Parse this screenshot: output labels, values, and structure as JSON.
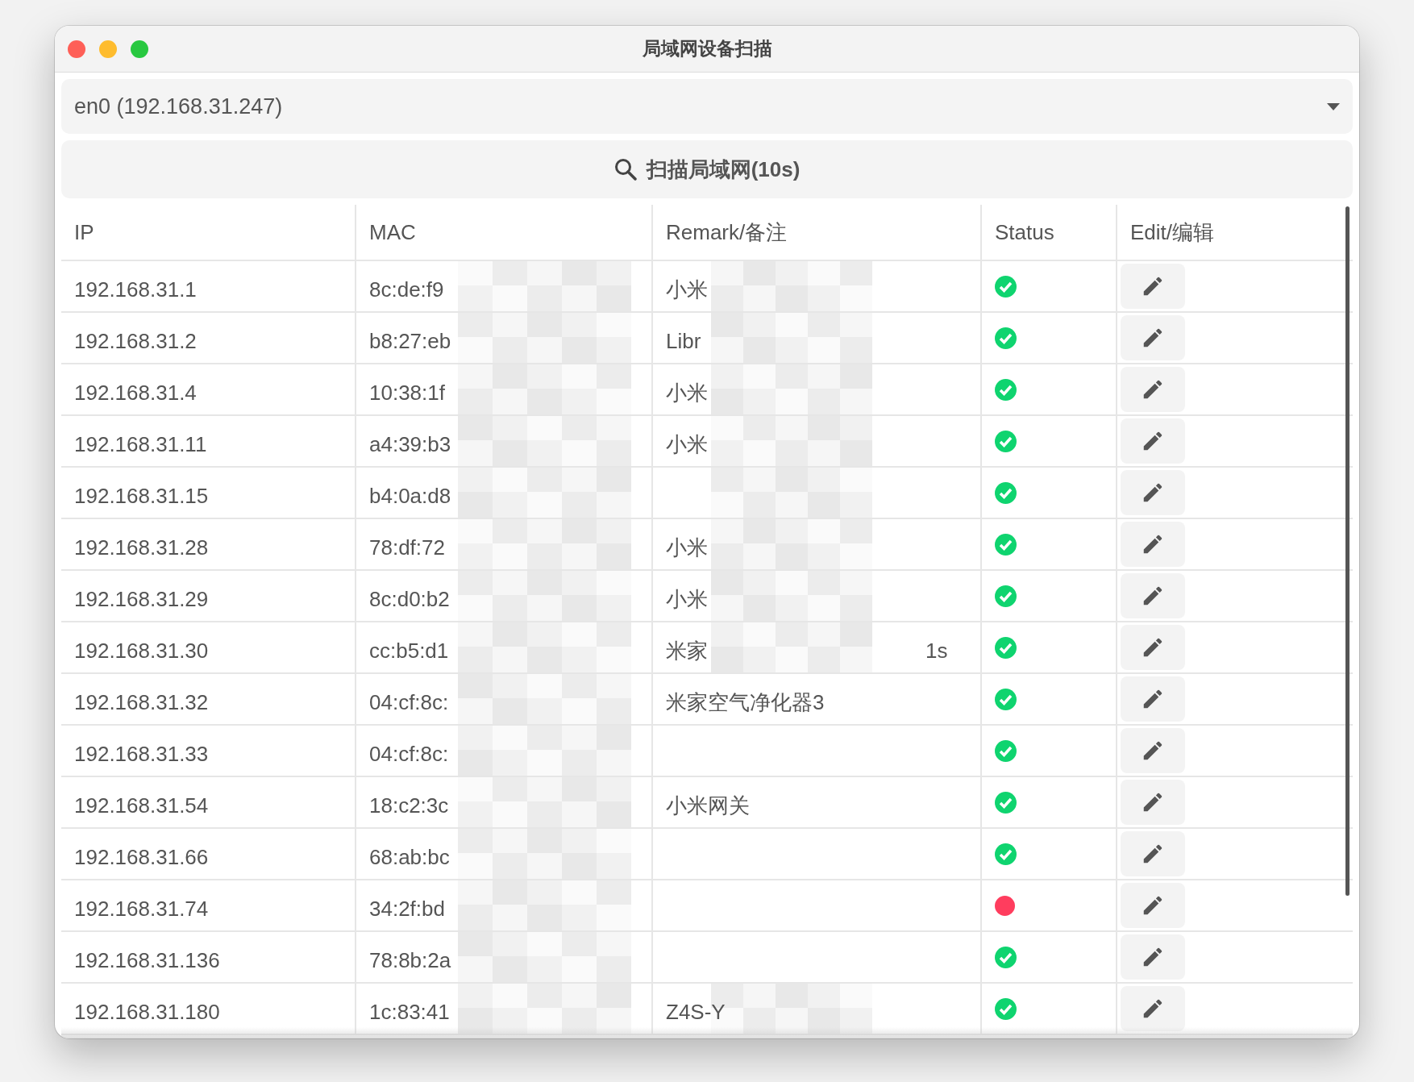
{
  "window": {
    "title": "局域网设备扫描"
  },
  "interface_select": {
    "value": "en0 (192.168.31.247)"
  },
  "scan_button": {
    "label": "扫描局域网(10s)"
  },
  "table": {
    "columns": [
      "IP",
      "MAC",
      "Remark/备注",
      "Status",
      "Edit/编辑"
    ],
    "rows": [
      {
        "ip": "192.168.31.1",
        "mac": "8c:de:f9",
        "mac_redacted": true,
        "remark": "小米",
        "remark_redacted": true,
        "online": true
      },
      {
        "ip": "192.168.31.2",
        "mac": "b8:27:eb",
        "mac_redacted": true,
        "remark": "Libr",
        "remark_redacted": true,
        "online": true
      },
      {
        "ip": "192.168.31.4",
        "mac": "10:38:1f",
        "mac_redacted": true,
        "remark": "小米",
        "remark_redacted": true,
        "online": true
      },
      {
        "ip": "192.168.31.11",
        "mac": "a4:39:b3",
        "mac_redacted": true,
        "remark": "小米",
        "remark_redacted": true,
        "online": true
      },
      {
        "ip": "192.168.31.15",
        "mac": "b4:0a:d8",
        "mac_redacted": true,
        "remark_redacted": true,
        "online": true
      },
      {
        "ip": "192.168.31.28",
        "mac": "78:df:72",
        "mac_redacted": true,
        "remark": "小米",
        "remark_redacted": true,
        "online": true
      },
      {
        "ip": "192.168.31.29",
        "mac": "8c:d0:b2",
        "mac_redacted": true,
        "remark": "小米",
        "remark_redacted": true,
        "online": true
      },
      {
        "ip": "192.168.31.30",
        "mac": "cc:b5:d1",
        "mac_redacted": true,
        "remark": "米家",
        "remark_tail": "1s",
        "remark_redacted": true,
        "online": true
      },
      {
        "ip": "192.168.31.32",
        "mac": "04:cf:8c:",
        "mac_redacted": true,
        "remark": "米家空气净化器3",
        "online": true
      },
      {
        "ip": "192.168.31.33",
        "mac": "04:cf:8c:",
        "mac_redacted": true,
        "online": true
      },
      {
        "ip": "192.168.31.54",
        "mac": "18:c2:3c",
        "mac_redacted": true,
        "remark": "小米网关",
        "online": true
      },
      {
        "ip": "192.168.31.66",
        "mac": "68:ab:bc",
        "mac_redacted": true,
        "online": true
      },
      {
        "ip": "192.168.31.74",
        "mac": "34:2f:bd",
        "mac_redacted": true,
        "online": false
      },
      {
        "ip": "192.168.31.136",
        "mac": "78:8b:2a",
        "mac_redacted": true,
        "online": true
      },
      {
        "ip": "192.168.31.180",
        "mac": "1c:83:41",
        "mac_redacted": true,
        "remark": "Z4S-Y",
        "remark_redacted": true,
        "online": true
      }
    ]
  }
}
